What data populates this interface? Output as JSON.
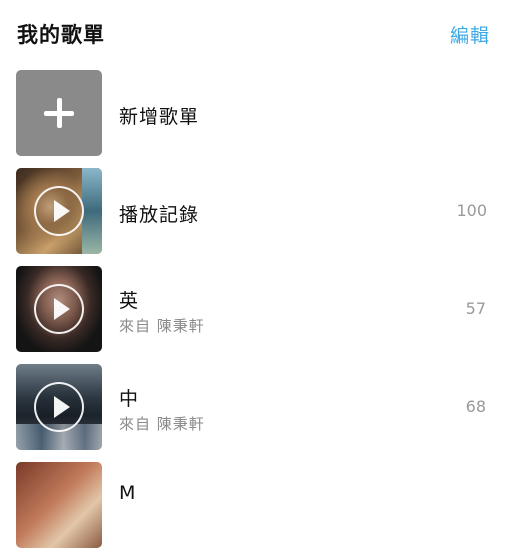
{
  "header": {
    "title": "我的歌單",
    "edit_label": "編輯"
  },
  "colors": {
    "accent": "#3ea9e6",
    "add_tile": "#8a8a8a",
    "secondary_text": "#8a8a8a",
    "count_text": "#9a9a9a"
  },
  "playlists": [
    {
      "title": "新增歌單",
      "icon": "plus-icon"
    },
    {
      "title": "播放記錄",
      "count": "100",
      "icon": "play-icon"
    },
    {
      "title": "英",
      "subtitle": "來自 陳秉軒",
      "count": "57",
      "icon": "play-icon"
    },
    {
      "title": "中",
      "subtitle": "來自 陳秉軒",
      "count": "68",
      "icon": "play-icon"
    },
    {
      "title": "M",
      "icon": "play-icon"
    }
  ]
}
